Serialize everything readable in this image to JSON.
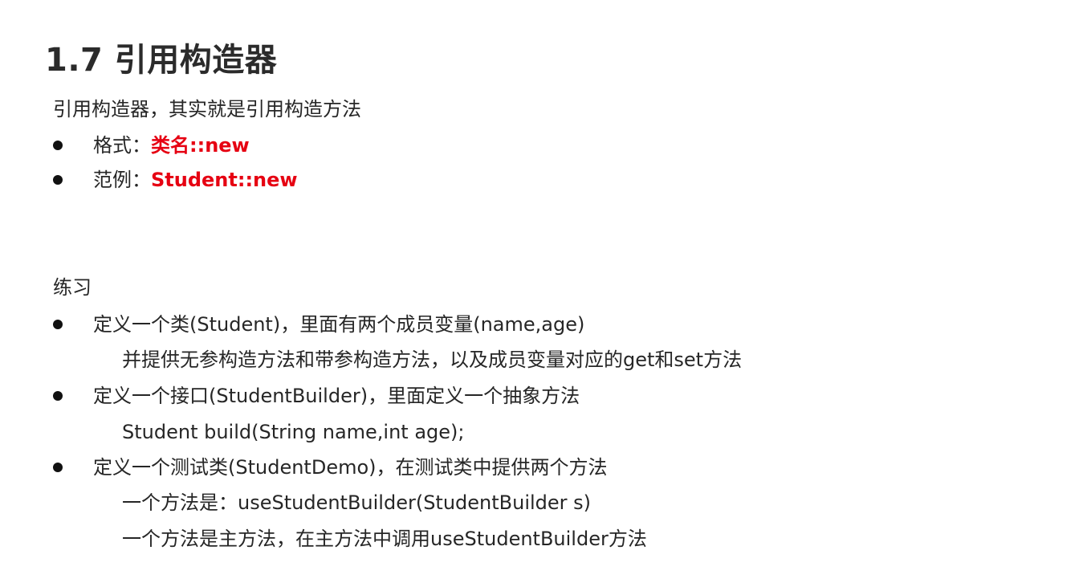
{
  "title": "1.7 引用构造器",
  "intro": "引用构造器，其实就是引用构造方法",
  "format": {
    "label": "格式：",
    "value": "类名::new"
  },
  "example": {
    "label": "范例：",
    "value": "Student::new"
  },
  "exercise": {
    "heading": "练习",
    "items": [
      {
        "line1": "定义一个类(Student)，里面有两个成员变量(name,age)",
        "line2": "并提供无参构造方法和带参构造方法，以及成员变量对应的get和set方法"
      },
      {
        "line1": "定义一个接口(StudentBuilder)，里面定义一个抽象方法",
        "line2": "Student build(String name,int age);"
      },
      {
        "line1": "定义一个测试类(StudentDemo)，在测试类中提供两个方法",
        "line2": "一个方法是：useStudentBuilder(StudentBuilder s)",
        "line3": "一个方法是主方法，在主方法中调用useStudentBuilder方法"
      }
    ]
  }
}
